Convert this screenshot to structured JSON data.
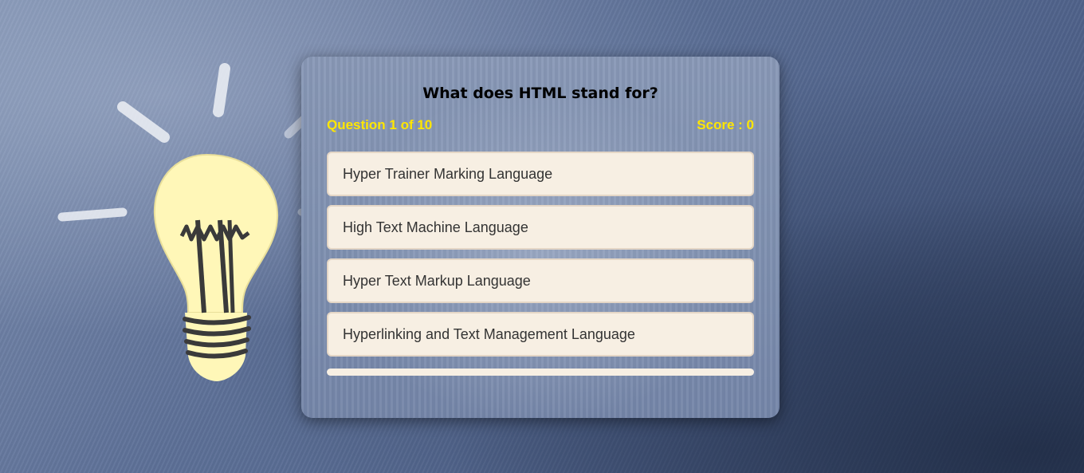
{
  "quiz": {
    "question": "What does HTML stand for?",
    "progress_label": "Question 1 of 10",
    "score_label": "Score : 0",
    "options": [
      {
        "label": "Hyper Trainer Marking Language"
      },
      {
        "label": "High Text Machine Language"
      },
      {
        "label": "Hyper Text Markup Language"
      },
      {
        "label": "Hyperlinking and Text Management Language"
      }
    ],
    "progress_fraction": 0
  },
  "colors": {
    "accent": "#ffe600",
    "option_bg": "#f7efe3",
    "card_bg": "#7f90b0"
  },
  "decoration": {
    "icon": "lightbulb-icon"
  }
}
